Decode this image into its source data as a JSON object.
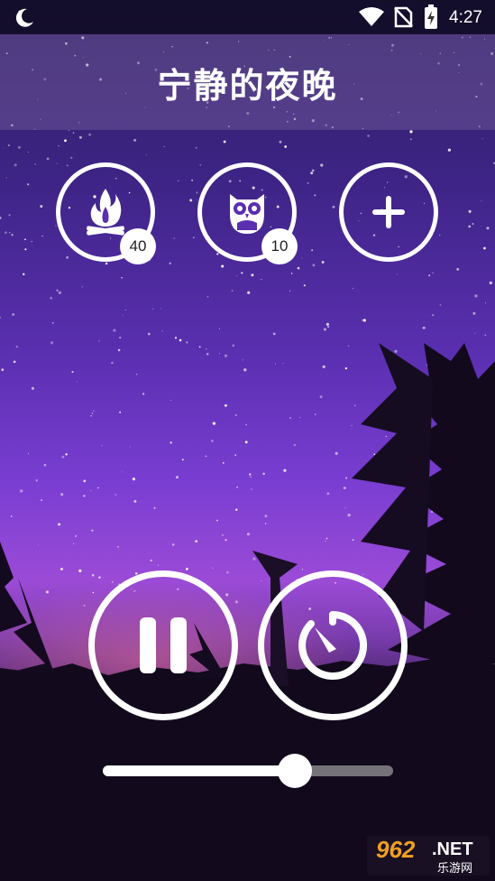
{
  "status_bar": {
    "time": "4:27",
    "icons": [
      "moon-icon",
      "wifi-icon",
      "no-sim-icon",
      "battery-charging-icon"
    ]
  },
  "header": {
    "title": "宁静的夜晚"
  },
  "sounds": [
    {
      "icon": "campfire-icon",
      "volume_label": "40"
    },
    {
      "icon": "owl-icon",
      "volume_label": "10"
    },
    {
      "icon": "add-icon"
    }
  ],
  "controls": {
    "play_state": "playing",
    "pause_icon": "pause-icon",
    "timer_icon": "timer-icon"
  },
  "volume": {
    "fraction": 0.66
  },
  "watermark": {
    "logo": "962",
    "net": ".NET",
    "sub": "乐游网"
  }
}
